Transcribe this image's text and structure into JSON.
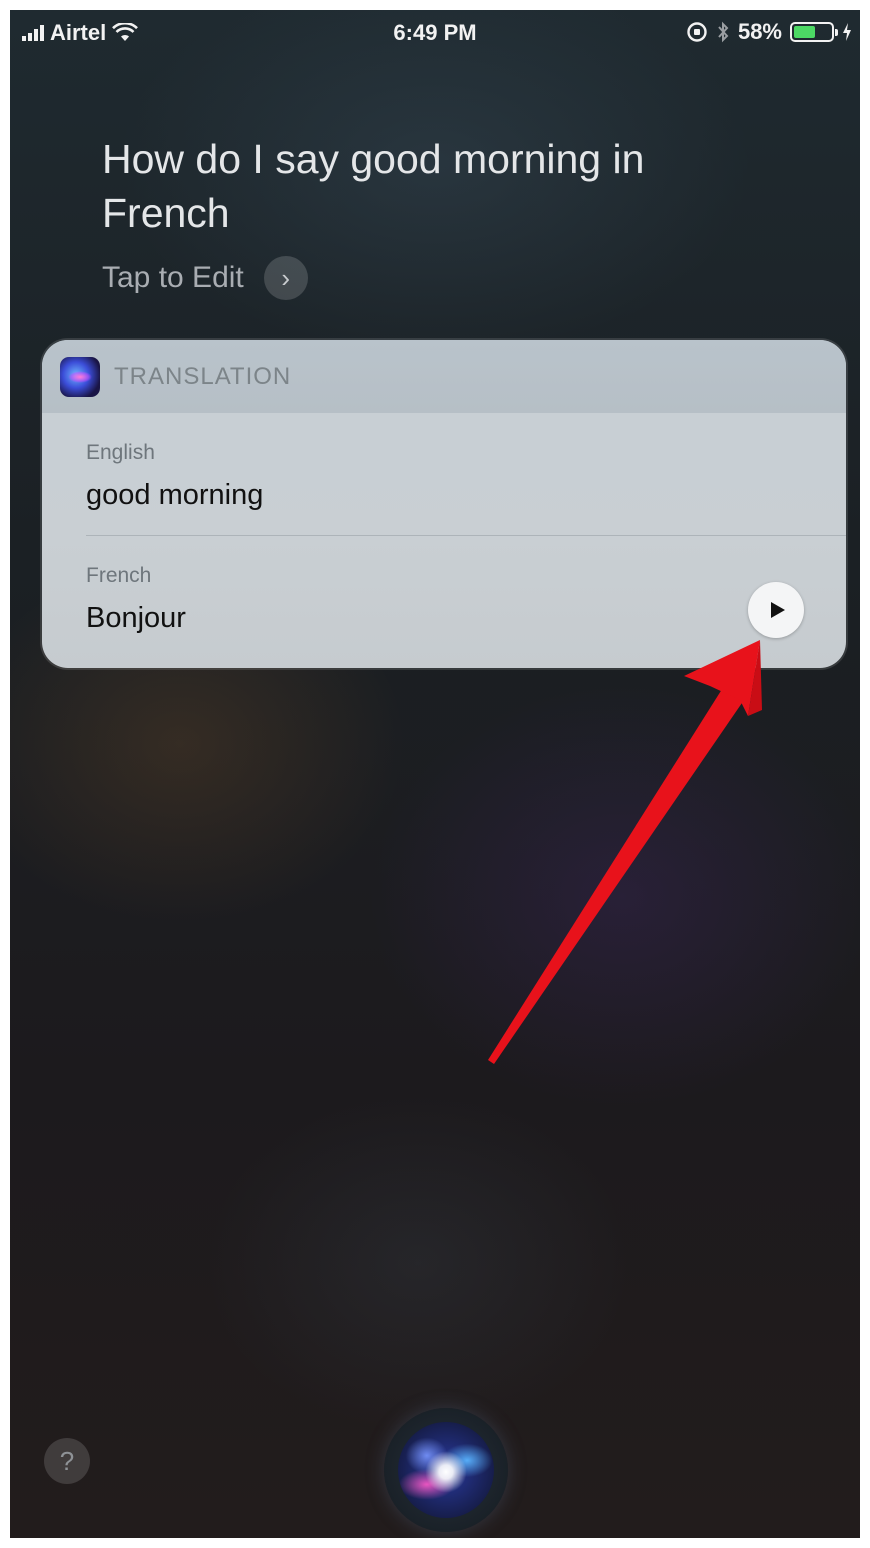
{
  "status_bar": {
    "carrier": "Airtel",
    "time": "6:49 PM",
    "battery_percent": "58%",
    "battery_level": 0.58
  },
  "siri": {
    "query": "How do I say good morning in French",
    "tap_to_edit": "Tap to Edit",
    "tap_chevron": "›"
  },
  "translation_card": {
    "header_label": "TRANSLATION",
    "source": {
      "language": "English",
      "text": "good morning"
    },
    "target": {
      "language": "French",
      "text": "Bonjour"
    }
  },
  "bottom": {
    "help": "?"
  },
  "colors": {
    "accent_arrow": "#e8121b",
    "battery": "#4cd964"
  }
}
